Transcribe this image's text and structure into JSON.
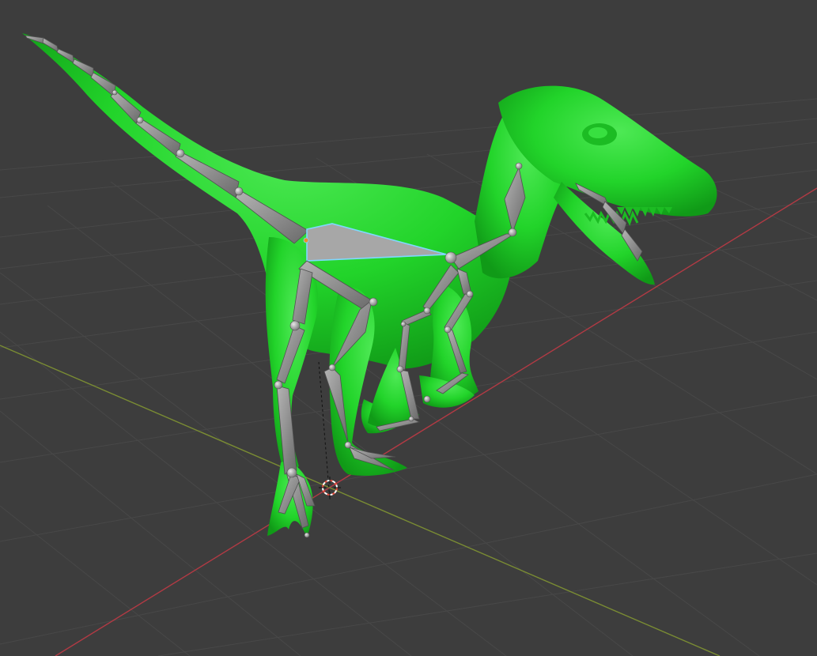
{
  "app": {
    "view": "3D Viewport",
    "mode": "Pose"
  },
  "scene": {
    "object": "dinosaur-mesh",
    "armature": "dinosaur-armature",
    "active_bone": "spine-bone",
    "colors": {
      "background": "#3d3d3d",
      "grid": "#4a4a4a",
      "x_axis": "#b23a44",
      "y_axis": "#7a8c33",
      "mesh": "#22d42a",
      "mesh_dark": "#15a01c",
      "bone": "#8f8f8f",
      "bone_dark": "#6c6c6c",
      "bone_selected_outline": "#7fd8ff",
      "cursor": "#e64c3c"
    }
  }
}
